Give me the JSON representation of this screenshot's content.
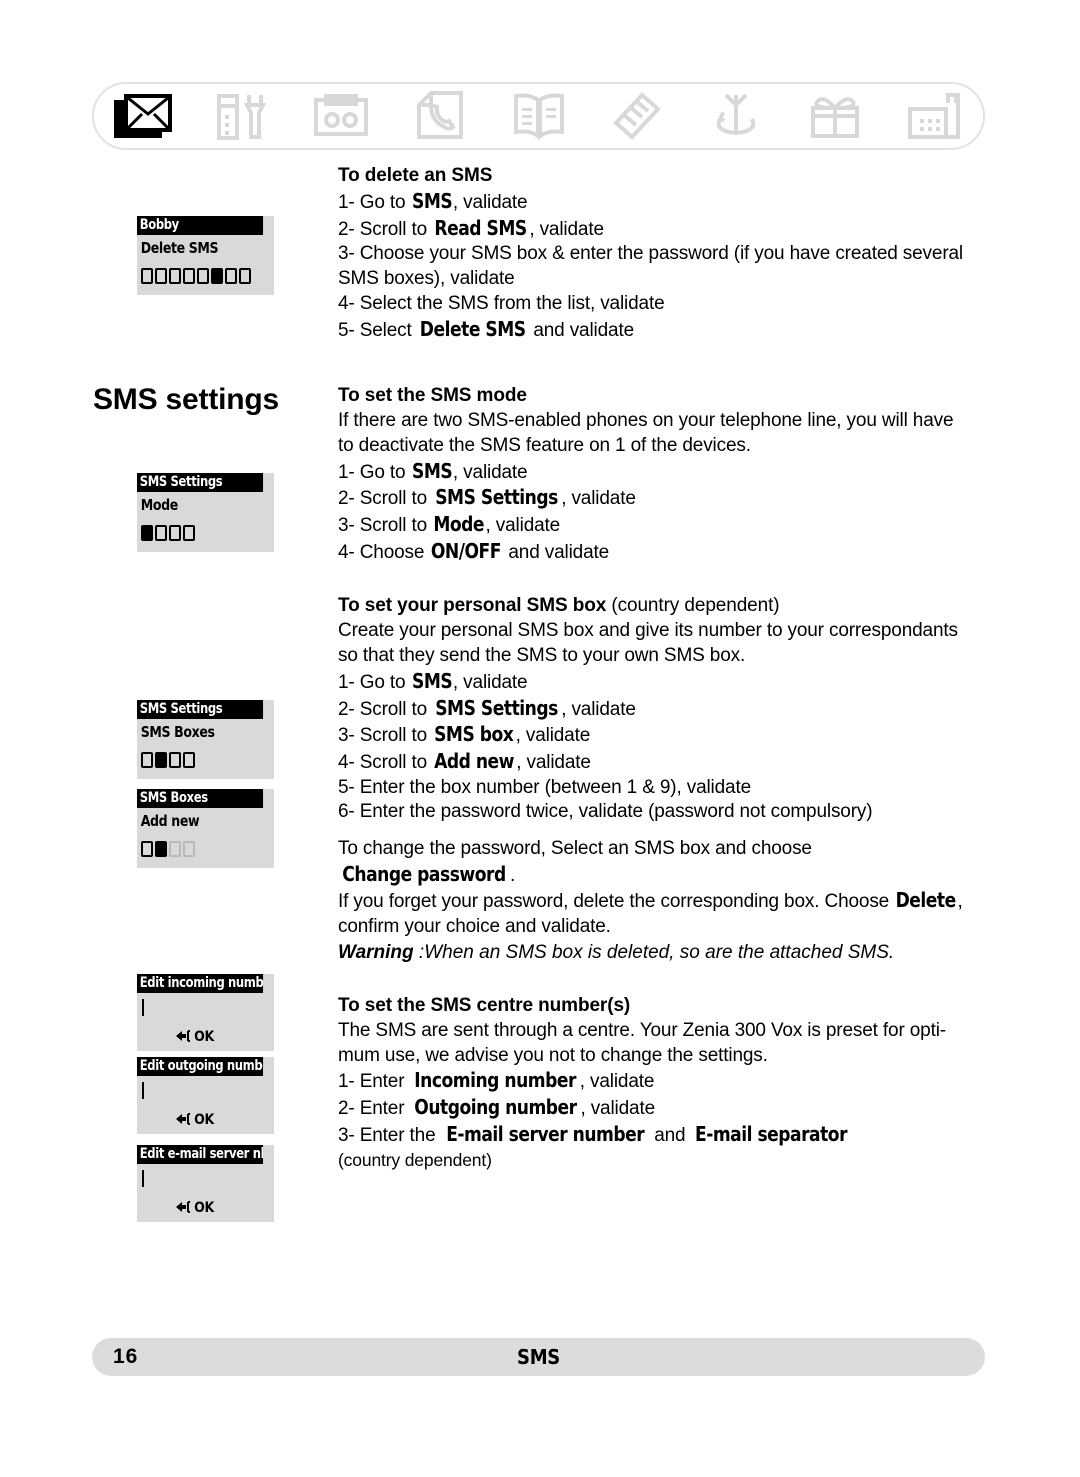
{
  "document": {
    "heading_bold": "SMS",
    "heading_rest": " settings"
  },
  "icon_bar": {
    "icons": [
      {
        "name": "sms-envelope-icon",
        "label": "SMS",
        "active": true
      },
      {
        "name": "settings-tools-icon",
        "label": "Settings",
        "active": false
      },
      {
        "name": "answering-machine-icon",
        "label": "Answering machine",
        "active": false
      },
      {
        "name": "call-log-icon",
        "label": "Call log",
        "active": false
      },
      {
        "name": "phonebook-icon",
        "label": "Phonebook",
        "active": false
      },
      {
        "name": "ringtones-icon",
        "label": "Ringtones",
        "active": false
      },
      {
        "name": "alarm-icon",
        "label": "Alarm",
        "active": false
      },
      {
        "name": "games-gift-icon",
        "label": "Extras",
        "active": false
      },
      {
        "name": "base-station-icon",
        "label": "Base",
        "active": false
      }
    ]
  },
  "screens": [
    {
      "id": "delete-sms",
      "title": "Bobby",
      "line": "Delete SMS",
      "dots": {
        "total": 8,
        "filled_index": 6,
        "ghost_from": 9
      }
    },
    {
      "id": "sms-settings-mode",
      "title": "SMS Settings",
      "line": "Mode",
      "dots": {
        "total": 4,
        "filled_index": 1,
        "ghost_from": 5
      }
    },
    {
      "id": "sms-settings-boxes",
      "title": "SMS Settings",
      "line": "SMS Boxes",
      "dots": {
        "total": 4,
        "filled_index": 2,
        "ghost_from": 5
      }
    },
    {
      "id": "sms-boxes-add-new",
      "title": "SMS Boxes",
      "line": "Add new",
      "dots": {
        "total": 4,
        "filled_index": 2,
        "ghost_from": 3
      }
    },
    {
      "id": "edit-incoming-number",
      "title": "Edit incoming number",
      "ok_label": "OK"
    },
    {
      "id": "edit-outgoing-number",
      "title": "Edit outgoing number",
      "ok_label": "OK"
    },
    {
      "id": "edit-email-server-nbr",
      "title": "Edit e-mail server nbr",
      "ok_label": "OK"
    }
  ],
  "sections": {
    "delete_sms": {
      "title": "To delete an SMS",
      "steps": [
        {
          "num": "1- ",
          "pre": "Go to ",
          "lcd": "SMS",
          "post": ", validate"
        },
        {
          "num": "2- ",
          "pre": "Scroll to ",
          "lcd": "Read  SMS",
          "post": ", validate"
        },
        {
          "num": "3- ",
          "pre": "Choose your SMS box & enter the password (if you have created several SMS boxes), validate",
          "lcd": "",
          "post": ""
        },
        {
          "num": "4- ",
          "pre": "Select the SMS from the list, validate",
          "lcd": "",
          "post": ""
        },
        {
          "num": "5- ",
          "pre": "Select ",
          "lcd": "Delete  SMS",
          "post": "  and validate"
        }
      ]
    },
    "sms_mode": {
      "title": "To set the SMS mode",
      "body": [
        "If there are two SMS-enabled phones on your telephone line, you will have",
        "to deactivate the SMS feature on 1 of the devices."
      ],
      "steps": [
        {
          "num": "1- ",
          "pre": "Go to ",
          "lcd": "SMS",
          "post": ", validate"
        },
        {
          "num": "2- ",
          "pre": "Scroll to ",
          "lcd": "SMS  Settings",
          "post": ", validate"
        },
        {
          "num": "3- ",
          "pre": "Scroll to ",
          "lcd": "Mode",
          "post": ", validate"
        },
        {
          "num": "4- ",
          "pre": "Choose ",
          "lcd": "ON/OFF",
          "post": " and validate"
        }
      ]
    },
    "personal_box": {
      "title": "To set your personal SMS box",
      "title_suffix": " (country dependent)",
      "body": [
        "Create your personal SMS box and give its number to your correspondants",
        "so that they send the SMS to your own SMS box."
      ],
      "steps": [
        {
          "num": "1- ",
          "pre": "Go to ",
          "lcd": "SMS",
          "post": ", validate"
        },
        {
          "num": "2- ",
          "pre": "Scroll to ",
          "lcd": "SMS  Settings",
          "post": ", validate"
        },
        {
          "num": "3- ",
          "pre": "Scroll to ",
          "lcd": "SMS  box",
          "post": ", validate"
        },
        {
          "num": "4- ",
          "pre": "Scroll to ",
          "lcd": "Add  new",
          "post": ", validate"
        },
        {
          "num": "5- ",
          "pre": "Enter the box number (between 1 & 9), validate",
          "lcd": "",
          "post": ""
        },
        {
          "num": "6- ",
          "pre": "Enter the password twice, validate (password not compulsory)",
          "lcd": "",
          "post": ""
        }
      ],
      "password_paragraph": {
        "line1_pre": "To change the password, Select an SMS box and choose ",
        "line1_lcd": "Change password",
        "line1_post": ".",
        "line2_pre": "If you forget your password, delete the corresponding box. Choose ",
        "line2_lcd": "Delete",
        "line2_post": ",",
        "line3": "confirm your choice and validate."
      },
      "warning": {
        "label": "Warning",
        "text": " :When an SMS box is deleted, so are the attached SMS."
      }
    },
    "centre_numbers": {
      "title": "To set the SMS centre number(s)",
      "body": [
        "The SMS are sent through a centre. Your Zenia 300 Vox is preset for opti-",
        "mum use, we advise you not to change the settings."
      ],
      "steps": [
        {
          "num": "1- ",
          "pre": "Enter ",
          "lcd": "Incoming  number",
          "post": ", validate"
        },
        {
          "num": "2- ",
          "pre": "Enter ",
          "lcd": "Outgoing  number",
          "post": ", validate"
        }
      ],
      "step3": {
        "num": "3- ",
        "pre": "Enter the ",
        "lcd1": "E-mail  server  number",
        "mid": " and ",
        "lcd2": "E-mail  separator"
      },
      "step3_note": "(country dependent)"
    }
  },
  "footer": {
    "page_number": "16",
    "section_label": "SMS"
  }
}
